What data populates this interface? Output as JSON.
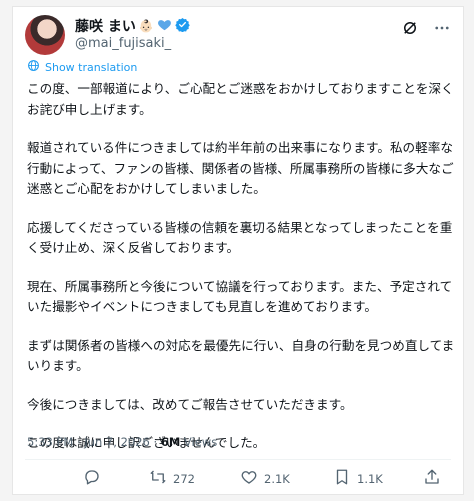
{
  "user": {
    "display_name": "藤咲 まい",
    "name_emoji": "👶🏻",
    "verified_icon": "verified-badge-icon",
    "handle": "@mai_fujisaki_"
  },
  "header_icons": [
    "grok-icon",
    "more-icon"
  ],
  "translate": {
    "label": "Show translation",
    "icon": "globe-icon"
  },
  "post": {
    "paragraphs": [
      "この度、一部報道により、ご心配とご迷惑をおかけしておりますことを深くお詫び申し上げます。",
      "報道されている件につきましては約半年前の出来事になります。私の軽率な行動によって、ファンの皆様、関係者の皆様、所属事務所の皆様に多大なご迷惑とご心配をおかけしてしまいました。",
      "応援してくださっている皆様の信頼を裏切る結果となってしまったことを重く受け止め、深く反省しております。",
      "現在、所属事務所と今後について協議を行っております。また、予定されていた撮影やイベントにつきましても見直しを進めております。",
      "まずは関係者の皆様への対応を最優先に行い、自身の行動を見つめ直してまいります。",
      "今後につきましては、改めてご報告させていただきます。",
      "この度は誠に申し訳ございませんでした。"
    ]
  },
  "meta": {
    "time": "5:33 PM",
    "separator1": " · ",
    "date": "Jun 7, 2026",
    "separator2": " · ",
    "views_count": "6M",
    "views_label": " Views"
  },
  "actions": {
    "reply": {
      "icon": "reply-icon",
      "count": ""
    },
    "repost": {
      "icon": "repost-icon",
      "count": "272"
    },
    "like": {
      "icon": "heart-icon",
      "count": "2.1K"
    },
    "bookmark": {
      "icon": "bookmark-icon",
      "count": "1.1K"
    },
    "share": {
      "icon": "share-icon",
      "count": ""
    }
  },
  "colors": {
    "accent": "#1d9bf0",
    "muted": "#536471",
    "text": "#0f1419"
  }
}
